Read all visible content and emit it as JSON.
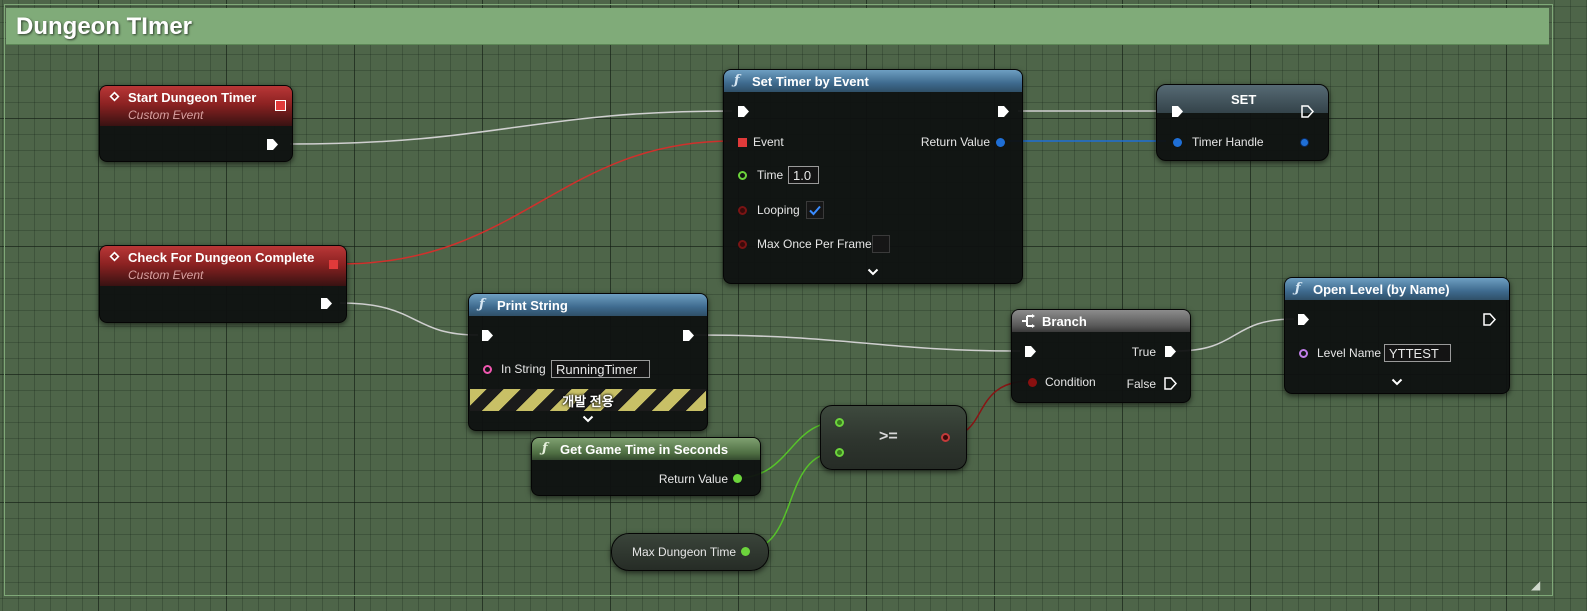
{
  "comment": {
    "title": "Dungeon TImer"
  },
  "colors": {
    "exec": "#ffffff",
    "event_pin": "#e03a3a",
    "float_pin": "#6cd43c",
    "bool_pin": "#8a1010",
    "string_pin": "#f057b0",
    "handle_pin": "#1f6fd6",
    "name_pin": "#c07ee8",
    "grid_bg": "#4e6549",
    "comment_header": "#80ab79"
  },
  "nodes": {
    "start_timer": {
      "title": "Start Dungeon Timer",
      "subtitle": "Custom Event",
      "icon": "event-diamond-icon"
    },
    "check_complete": {
      "title": "Check For Dungeon Complete",
      "subtitle": "Custom Event",
      "icon": "event-diamond-icon"
    },
    "set_timer": {
      "title": "Set Timer by Event",
      "icon": "function-icon",
      "pins": {
        "event": "Event",
        "time": "Time",
        "looping": "Looping",
        "max_once": "Max Once Per Frame",
        "return_value": "Return Value"
      },
      "time_value": "1.0",
      "looping_checked": true,
      "max_once_checked": false
    },
    "set_node": {
      "title": "SET",
      "pins": {
        "timer_handle": "Timer Handle"
      }
    },
    "print_string": {
      "title": "Print String",
      "icon": "function-icon",
      "pins": {
        "in_string": "In String"
      },
      "in_string_value": "RunningTimer",
      "dev_only_label": "개발 전용"
    },
    "branch": {
      "title": "Branch",
      "icon": "branch-icon",
      "pins": {
        "condition": "Condition",
        "true": "True",
        "false": "False"
      }
    },
    "open_level": {
      "title": "Open Level (by Name)",
      "icon": "function-icon",
      "pins": {
        "level_name": "Level Name"
      },
      "level_name_value": "YTTEST"
    },
    "get_game_time": {
      "title": "Get Game Time in Seconds",
      "icon": "function-icon",
      "pins": {
        "return_value": "Return Value"
      }
    },
    "compare": {
      "op": ">="
    },
    "max_dungeon_time": {
      "label": "Max Dungeon Time"
    }
  }
}
